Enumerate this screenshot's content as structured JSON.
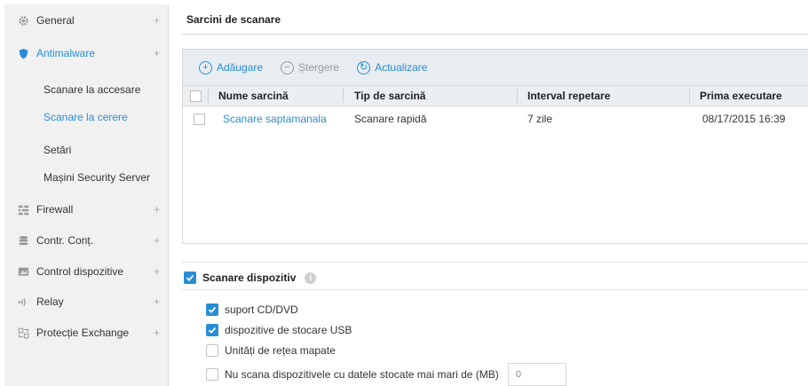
{
  "sidebar": {
    "items": [
      {
        "label": "General",
        "icon": "gear-icon",
        "expandable": true
      },
      {
        "label": "Antimalware",
        "icon": "shield-icon",
        "expandable": true,
        "active": true
      },
      {
        "label": "Scanare la accesare"
      },
      {
        "label": "Scanare la cerere",
        "active": true
      },
      {
        "label": "Setări"
      },
      {
        "label": "Mașini Security Server"
      },
      {
        "label": "Firewall",
        "icon": "firewall-icon",
        "expandable": true
      },
      {
        "label": "Contr. Conț.",
        "icon": "database-icon",
        "expandable": true
      },
      {
        "label": "Control dispozitive",
        "icon": "device-icon",
        "expandable": true
      },
      {
        "label": "Relay",
        "icon": "relay-icon",
        "expandable": true
      },
      {
        "label": "Protecție Exchange",
        "icon": "exchange-icon",
        "expandable": true
      }
    ],
    "plus": "+"
  },
  "main": {
    "title": "Sarcini de scanare",
    "toolbar": {
      "add": "Adăugare",
      "delete": "Ștergere",
      "refresh": "Actualizare"
    },
    "table": {
      "columns": [
        "Nume sarcină",
        "Tip de sarcină",
        "Interval repetare",
        "Prima executare"
      ],
      "rows": [
        [
          "Scanare saptamanala",
          "Scanare rapidă",
          "7 zile",
          "08/17/2015 16:39"
        ]
      ]
    },
    "device_scan": {
      "label": "Scanare dispozitiv",
      "options": [
        {
          "label": "suport CD/DVD",
          "checked": true
        },
        {
          "label": "dispozitive de stocare USB",
          "checked": true
        },
        {
          "label": "Unități de rețea mapate",
          "checked": false
        },
        {
          "label": "Nu scana dispozitivele cu datele stocate mai mari de (MB)",
          "checked": false
        }
      ],
      "size_value": "0"
    }
  },
  "colors": {
    "accent": "#2a8dd4",
    "sidebar_bg": "#f1f1f1",
    "toolbar_bg": "#e8edf1"
  }
}
